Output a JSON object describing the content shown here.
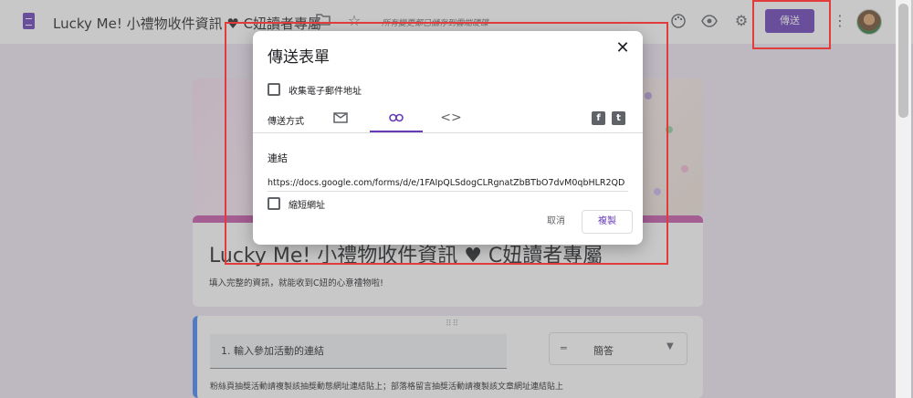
{
  "topbar": {
    "title": "Lucky Me!  小禮物收件資訊 ♥ C妞讀者專屬",
    "save_status": "所有變更都已儲存到雲端硬碟",
    "send_label": "傳送"
  },
  "form": {
    "title": "Lucky Me!  小禮物收件資訊 ♥ C妞讀者專屬",
    "description": "填入完整的資訊，就能收到C妞的心意禮物啦!",
    "question": {
      "title": "1. 輸入參加活動的連結",
      "type": "簡答",
      "description": "粉絲頁抽獎活動請複製該抽獎動態網址連結貼上；部落格留言抽獎活動請複製該文章網址連結貼上"
    }
  },
  "dialog": {
    "title": "傳送表單",
    "collect_email": "收集電子郵件地址",
    "send_via": "傳送方式",
    "link_label": "連結",
    "link_url": "https://docs.google.com/forms/d/e/1FAIpQLSdogCLRgnatZbBTbO7dvM0qbHLR2QD",
    "shorten_url": "縮短網址",
    "cancel": "取消",
    "copy": "複製"
  },
  "colors": {
    "accent": "#673ab7",
    "header_accent": "#c554a9",
    "highlight": "#e23b3b"
  },
  "icons": [
    "app-icon",
    "folder-icon",
    "star-icon",
    "palette-icon",
    "eye-icon",
    "gear-icon",
    "more-icon",
    "email-icon",
    "link-icon",
    "embed-icon",
    "facebook-icon",
    "twitter-icon",
    "close-icon",
    "short-answer-icon",
    "dropdown-arrow-icon"
  ]
}
